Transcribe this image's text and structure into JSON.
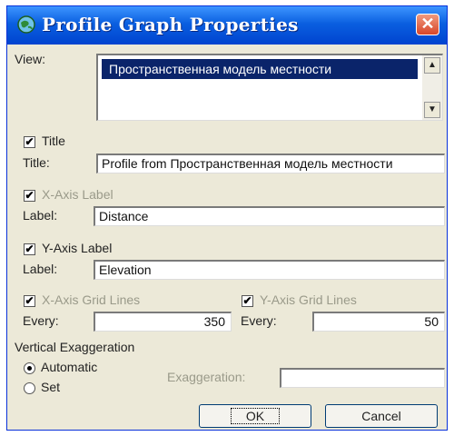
{
  "window": {
    "title": "Profile Graph Properties",
    "close_icon": "close-icon",
    "app_icon": "globe-icon"
  },
  "view": {
    "label": "View:",
    "selected_item": "Пространственная модель местности"
  },
  "title_section": {
    "checkbox_label": "Title",
    "checked": true,
    "field_label": "Title:",
    "value": "Profile from Пространственная модель местности"
  },
  "x_axis_label": {
    "checkbox_label": "X-Axis Label",
    "checked": true,
    "field_label": "Label:",
    "value": "Distance"
  },
  "y_axis_label": {
    "checkbox_label": "Y-Axis Label",
    "checked": true,
    "field_label": "Label:",
    "value": "Elevation"
  },
  "x_grid": {
    "checkbox_label": "X-Axis Grid Lines",
    "checked": true,
    "every_label": "Every:",
    "value": "350"
  },
  "y_grid": {
    "checkbox_label": "Y-Axis Grid Lines",
    "checked": true,
    "every_label": "Every:",
    "value": "50"
  },
  "exaggeration": {
    "group_label": "Vertical Exaggeration",
    "automatic_label": "Automatic",
    "set_label": "Set",
    "selected": "Automatic",
    "field_label": "Exaggeration:",
    "value": ""
  },
  "buttons": {
    "ok": "OK",
    "cancel": "Cancel"
  },
  "check_mark": "✔",
  "scroll_up": "▲",
  "scroll_down": "▼"
}
